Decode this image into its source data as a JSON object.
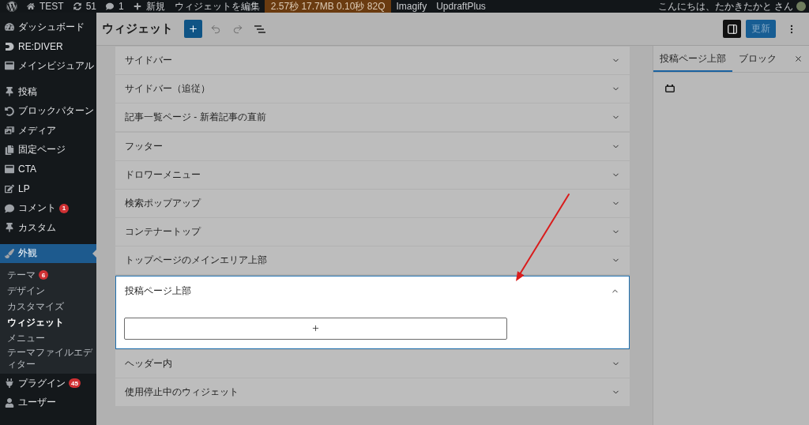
{
  "admin_bar": {
    "items": [
      {
        "kind": "logo"
      },
      {
        "kind": "site",
        "label": "TEST"
      },
      {
        "kind": "updates",
        "label": "51"
      },
      {
        "kind": "comments",
        "label": "1"
      },
      {
        "kind": "new",
        "label": "新規"
      },
      {
        "kind": "link",
        "label": "ウィジェットを編集"
      },
      {
        "kind": "metrics",
        "label": "2.57秒 17.7MB 0.10秒 82Q"
      },
      {
        "kind": "link",
        "label": "Imagify"
      },
      {
        "kind": "link",
        "label": "UpdraftPlus"
      }
    ],
    "greeting": "こんにちは、たかきたかと さん"
  },
  "sidebar": {
    "sections": [
      {
        "items": [
          {
            "kind": "dashboard",
            "label": "ダッシュボード",
            "selected": false
          },
          {
            "kind": "logo",
            "label": "RE:DIVER",
            "selected": false
          },
          {
            "kind": "layout",
            "label": "メインビジュアル",
            "selected": false
          }
        ]
      },
      {
        "items": [
          {
            "kind": "pin",
            "label": "投稿",
            "selected": false
          },
          {
            "kind": "patterns",
            "label": "ブロックパターン",
            "selected": false
          },
          {
            "kind": "media",
            "label": "メディア",
            "selected": false
          },
          {
            "kind": "pages",
            "label": "固定ページ",
            "selected": false
          },
          {
            "kind": "layout",
            "label": "CTA",
            "selected": false
          },
          {
            "kind": "edit",
            "label": "LP",
            "selected": false
          },
          {
            "kind": "comment",
            "label": "コメント",
            "badge": "1",
            "selected": false
          },
          {
            "kind": "pin",
            "label": "カスタム",
            "selected": false
          }
        ]
      },
      {
        "items": [
          {
            "kind": "brush",
            "label": "外観",
            "selected": true,
            "children": [
              {
                "label": "テーマ",
                "badge": "6",
                "selected": false
              },
              {
                "label": "デザイン",
                "selected": false
              },
              {
                "label": "カスタマイズ",
                "selected": false
              },
              {
                "label": "ウィジェット",
                "selected": true
              },
              {
                "label": "メニュー",
                "selected": false
              },
              {
                "label": "テーマファイルエディター",
                "selected": false
              }
            ]
          },
          {
            "kind": "plugin",
            "label": "プラグイン",
            "badge": "45",
            "selected": false
          },
          {
            "kind": "user",
            "label": "ユーザー",
            "selected": false
          }
        ]
      }
    ]
  },
  "editor_header": {
    "title": "ウィジェット",
    "sidebar_toggle_pressed": true,
    "update_button": {
      "label": "更新",
      "disabled": true
    }
  },
  "widget_areas": [
    {
      "title": "サイドバー",
      "expanded": false
    },
    {
      "title": "サイドバー（追従）",
      "expanded": false
    },
    {
      "title": "記事一覧ページ - 新着記事の直前",
      "expanded": false
    },
    {
      "title": "フッター",
      "expanded": false
    },
    {
      "title": "ドロワーメニュー",
      "expanded": false
    },
    {
      "title": "検索ポップアップ",
      "expanded": false
    },
    {
      "title": "コンテナートップ",
      "expanded": false
    },
    {
      "title": "トップページのメインエリア上部",
      "expanded": false
    },
    {
      "title": "投稿ページ上部",
      "expanded": true
    },
    {
      "title": "ヘッダー内",
      "expanded": false
    },
    {
      "title": "使用停止中のウィジェット",
      "expanded": false
    }
  ],
  "inspector": {
    "tabs": [
      {
        "label": "投稿ページ上部",
        "selected": true
      },
      {
        "label": "ブロック",
        "selected": false
      }
    ]
  }
}
